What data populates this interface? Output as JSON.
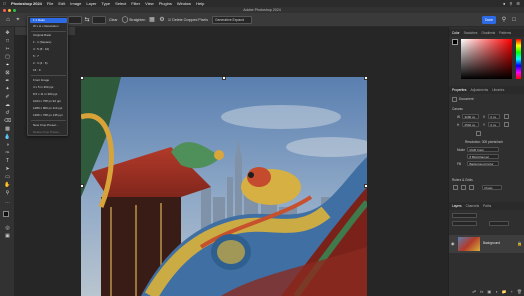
{
  "menubar": {
    "apple": "",
    "items": [
      "Photoshop 2024",
      "File",
      "Edit",
      "Image",
      "Layer",
      "Type",
      "Select",
      "Filter",
      "View",
      "Plugins",
      "Window",
      "Help"
    ]
  },
  "window": {
    "title": "Adobe Photoshop 2024"
  },
  "options_bar": {
    "ratio_value": "1:1 Ratio",
    "straighten_label": "Straighten",
    "delete_cropped_label": "Delete Cropped Pixels",
    "fill_value": "Generative Expand",
    "action_button": "Done"
  },
  "dropdown": {
    "items": [
      {
        "label": "1:1 Ratio",
        "selected": true
      },
      {
        "label": "W x H x Resolution",
        "selected": false
      },
      {
        "label": "Original Ratio",
        "selected": false
      },
      {
        "label": "1 : 1 (Square)",
        "selected": false
      },
      {
        "label": "4 : 5 (8 : 10)",
        "selected": false
      },
      {
        "label": "5 : 7",
        "selected": false
      },
      {
        "label": "2 : 3 (4 : 6)",
        "selected": false
      },
      {
        "label": "16 : 9",
        "selected": false
      },
      {
        "label": "Front Image",
        "selected": false
      },
      {
        "label": "4 x 5 in 300 ppi",
        "selected": false
      },
      {
        "label": "8.5 x 11 in 300 ppi",
        "selected": false
      },
      {
        "label": "1024 x 768 px 92 ppi",
        "selected": false
      },
      {
        "label": "1280 x 800 px 113 ppi",
        "selected": false
      },
      {
        "label": "1366 x 768 px 135 ppi",
        "selected": false
      },
      {
        "label": "New Crop Preset...",
        "selected": false
      },
      {
        "label": "Delete Crop Preset...",
        "selected": false,
        "dim": true
      }
    ]
  },
  "color_panel": {
    "tabs": [
      "Color",
      "Swatches",
      "Gradients",
      "Patterns"
    ]
  },
  "properties_panel": {
    "tabs": [
      "Properties",
      "Adjustments",
      "Libraries"
    ],
    "doc_label": "Document",
    "canvas_label": "Canvas",
    "w_value": "3290 px",
    "h_value": "2592 px",
    "x_value": "0 px",
    "y_value": "0 px",
    "resolution_label": "Resolution: 300 pixels/inch",
    "mode_label": "Mode",
    "mode_value": "RGB Color",
    "depth_value": "8 Bits/Channel",
    "fill_label": "Fill",
    "fill_value": "Background Color",
    "rulers_label": "Rulers & Grids",
    "units_value": "Pixels"
  },
  "layers_panel": {
    "tabs": [
      "Layers",
      "Channels",
      "Paths"
    ],
    "layers": [
      {
        "name": "Background",
        "visible": true
      }
    ]
  },
  "colors": {
    "accent": "#2d6be6",
    "panel": "#2f2f2f",
    "canvas_bg": "#262626"
  }
}
